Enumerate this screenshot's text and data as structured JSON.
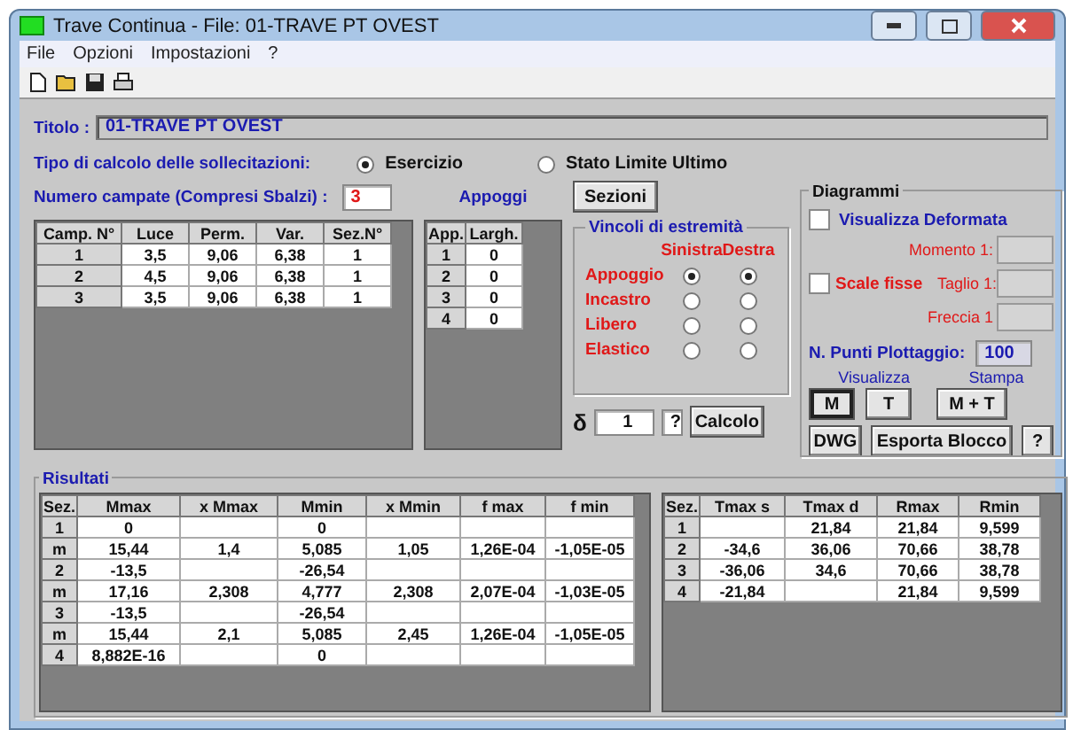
{
  "window": {
    "title": "Trave Continua - File: 01-TRAVE PT OVEST"
  },
  "menu": [
    "File",
    "Opzioni",
    "Impostazioni",
    "?"
  ],
  "titolo": {
    "label": "Titolo :",
    "value": "01-TRAVE PT OVEST"
  },
  "calc_type": {
    "label": "Tipo di calcolo delle sollecitazioni:",
    "options": [
      {
        "label": "Esercizio",
        "selected": true
      },
      {
        "label": "Stato Limite Ultimo",
        "selected": false
      }
    ]
  },
  "campate": {
    "label": "Numero campate (Compresi Sbalzi) :",
    "value": "3",
    "columns": [
      "Camp. N°",
      "Luce",
      "Perm.",
      "Var.",
      "Sez.N°"
    ],
    "rows": [
      [
        "1",
        "3,5",
        "9,06",
        "6,38",
        "1"
      ],
      [
        "2",
        "4,5",
        "9,06",
        "6,38",
        "1"
      ],
      [
        "3",
        "3,5",
        "9,06",
        "6,38",
        "1"
      ]
    ]
  },
  "appoggi": {
    "label": "Appoggi",
    "columns": [
      "App.",
      "Largh."
    ],
    "rows": [
      [
        "1",
        "0"
      ],
      [
        "2",
        "0"
      ],
      [
        "3",
        "0"
      ],
      [
        "4",
        "0"
      ]
    ]
  },
  "sezioni_button": "Sezioni",
  "vincoli": {
    "title": "Vincoli di estremità",
    "columns": [
      "Sinistra",
      "Destra"
    ],
    "rows": [
      {
        "label": "Appoggio",
        "left_selected": true,
        "right_selected": true
      },
      {
        "label": "Incastro",
        "left_selected": false,
        "right_selected": false
      },
      {
        "label": "Libero",
        "left_selected": false,
        "right_selected": false
      },
      {
        "label": "Elastico",
        "left_selected": false,
        "right_selected": false
      }
    ]
  },
  "delta": {
    "symbol": "δ",
    "value": "1",
    "help": "?",
    "button": "Calcolo"
  },
  "diagrammi": {
    "title": "Diagrammi",
    "deformata": {
      "label": "Visualizza Deformata",
      "checked": false
    },
    "momento": {
      "label": "Momento 1:"
    },
    "scale": {
      "label": "Scale fisse",
      "checked": false
    },
    "taglio": {
      "label": "Taglio 1:"
    },
    "freccia": {
      "label": "Freccia 1"
    },
    "punti": {
      "label": "N. Punti Plottaggio:",
      "value": "100"
    },
    "visualizza_label": "Visualizza",
    "stampa_label": "Stampa",
    "view_buttons": [
      {
        "label": "M",
        "selected": true
      },
      {
        "label": "T",
        "selected": false
      }
    ],
    "print_button": "M + T",
    "bottom_buttons": [
      "DWG",
      "Esporta Blocco",
      "?"
    ]
  },
  "risultati": {
    "title": "Risultati",
    "left": {
      "columns": [
        "Sez.",
        "Mmax",
        "x Mmax",
        "Mmin",
        "x Mmin",
        "f max",
        "f min"
      ],
      "rows": [
        [
          "1",
          "0",
          "",
          "0",
          "",
          "",
          ""
        ],
        [
          "m",
          "15,44",
          "1,4",
          "5,085",
          "1,05",
          "1,26E-04",
          "-1,05E-05"
        ],
        [
          "2",
          "-13,5",
          "",
          "-26,54",
          "",
          "",
          ""
        ],
        [
          "m",
          "17,16",
          "2,308",
          "4,777",
          "2,308",
          "2,07E-04",
          "-1,03E-05"
        ],
        [
          "3",
          "-13,5",
          "",
          "-26,54",
          "",
          "",
          ""
        ],
        [
          "m",
          "15,44",
          "2,1",
          "5,085",
          "2,45",
          "1,26E-04",
          "-1,05E-05"
        ],
        [
          "4",
          "8,882E-16",
          "",
          "0",
          "",
          "",
          ""
        ]
      ]
    },
    "right": {
      "columns": [
        "Sez.",
        "Tmax s",
        "Tmax d",
        "Rmax",
        "Rmin"
      ],
      "rows": [
        [
          "1",
          "",
          "21,84",
          "21,84",
          "9,599"
        ],
        [
          "2",
          "-34,6",
          "36,06",
          "70,66",
          "38,78"
        ],
        [
          "3",
          "-36,06",
          "34,6",
          "70,66",
          "38,78"
        ],
        [
          "4",
          "-21,84",
          "",
          "21,84",
          "9,599"
        ]
      ]
    }
  }
}
